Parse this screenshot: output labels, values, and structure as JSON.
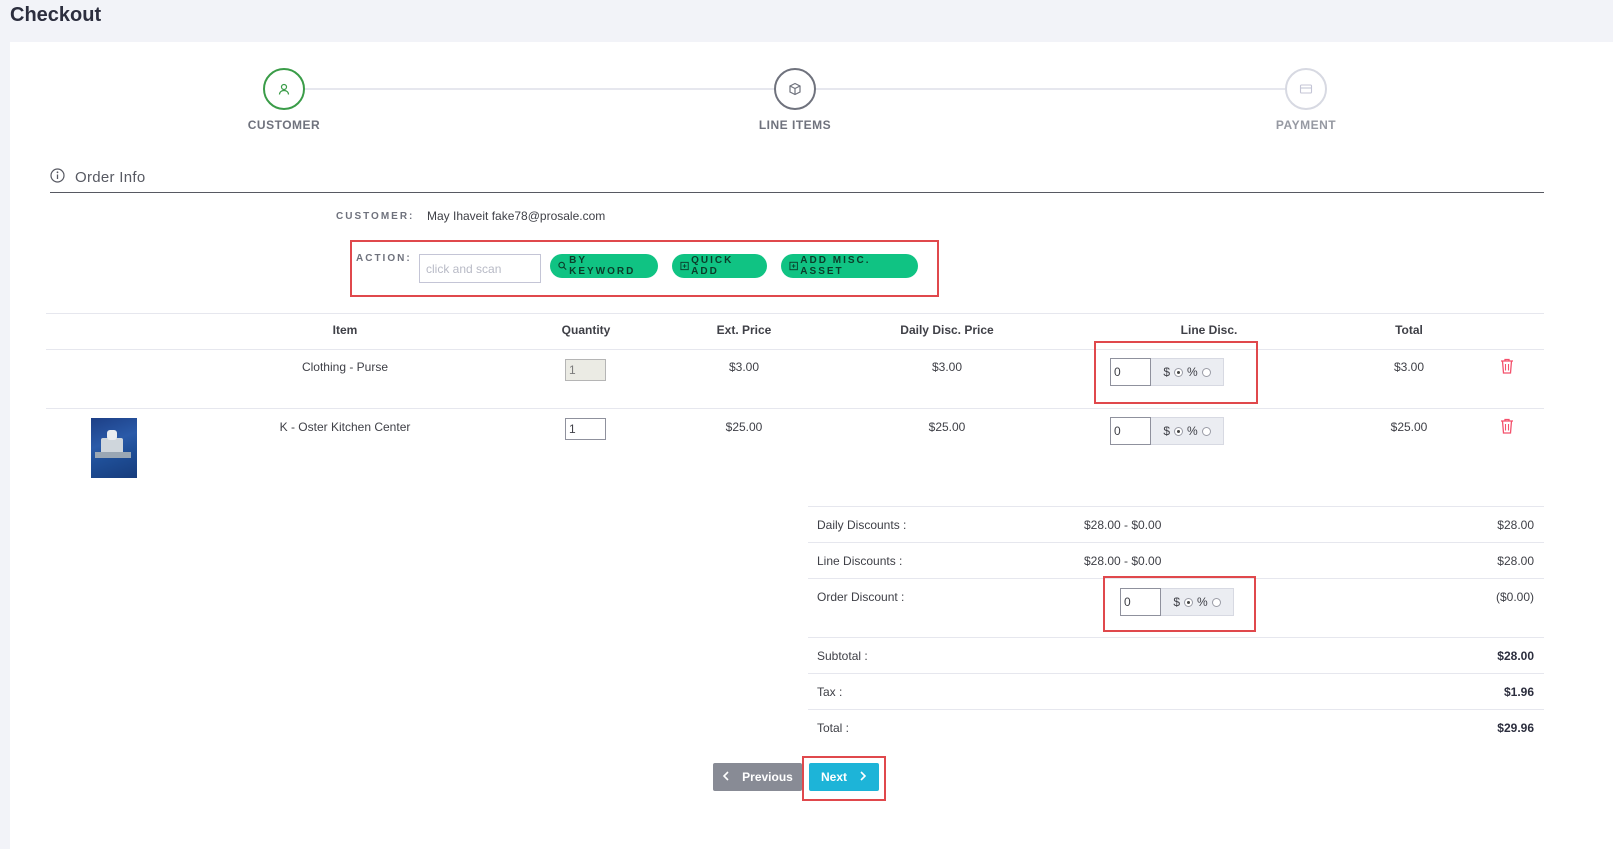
{
  "page": {
    "title": "Checkout"
  },
  "wizard": {
    "steps": [
      {
        "label": "CUSTOMER",
        "icon": "user-icon",
        "state": "done"
      },
      {
        "label": "LINE ITEMS",
        "icon": "box-icon",
        "state": "active"
      },
      {
        "label": "PAYMENT",
        "icon": "credit-card-icon",
        "state": "pending"
      }
    ]
  },
  "order_info": {
    "title": "Order Info",
    "customer_label": "CUSTOMER:",
    "customer_value": "May Ihaveit fake78@prosale.com",
    "action_label": "ACTION:",
    "scan_placeholder": "click and scan",
    "buttons": {
      "by_keyword": "BY KEYWORD",
      "quick_add": "QUICK ADD",
      "add_misc_asset": "ADD MISC. ASSET"
    }
  },
  "table": {
    "headers": [
      "Item",
      "Quantity",
      "Ext. Price",
      "Daily Disc. Price",
      "Line Disc.",
      "Total"
    ],
    "rows": [
      {
        "item": "Clothing - Purse",
        "quantity": "1",
        "quantity_disabled": true,
        "ext_price": "$3.00",
        "daily_disc_price": "$3.00",
        "line_disc": "0",
        "total": "$3.00",
        "has_image": false
      },
      {
        "item": "K - Oster Kitchen Center",
        "quantity": "1",
        "quantity_disabled": false,
        "ext_price": "$25.00",
        "daily_disc_price": "$25.00",
        "line_disc": "0",
        "total": "$25.00",
        "has_image": true
      }
    ],
    "disc_currency": "$",
    "disc_percent": "%"
  },
  "summary": {
    "daily_discounts": {
      "label": "Daily Discounts :",
      "mid": "$28.00 - $0.00",
      "value": "$28.00"
    },
    "line_discounts": {
      "label": "Line Discounts :",
      "mid": "$28.00 - $0.00",
      "value": "$28.00"
    },
    "order_discount": {
      "label": "Order Discount :",
      "input": "0",
      "value": "($0.00)"
    },
    "subtotal": {
      "label": "Subtotal :",
      "value": "$28.00"
    },
    "tax": {
      "label": "Tax :",
      "value": "$1.96"
    },
    "total": {
      "label": "Total :",
      "value": "$29.96"
    }
  },
  "nav": {
    "previous": "Previous",
    "next": "Next"
  },
  "colors": {
    "accent_green": "#10c383",
    "next_blue": "#1db4d8",
    "highlight_red": "#e0484c",
    "trash_red": "#f4516c"
  }
}
